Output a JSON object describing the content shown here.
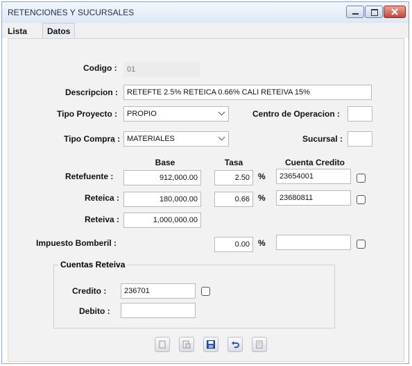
{
  "window": {
    "title": "RETENCIONES Y SUCURSALES"
  },
  "tabs": [
    {
      "label": "Lista"
    },
    {
      "label": "Datos"
    }
  ],
  "form": {
    "codigo": {
      "label": "Codigo :",
      "value": "01"
    },
    "descripcion": {
      "label": "Descripcion :",
      "value": "RETEFTE 2.5% RETEICA 0.66% CALI RETEIVA 15%"
    },
    "tipo_proyecto": {
      "label": "Tipo Proyecto :",
      "value": "PROPIO"
    },
    "centro_operacion": {
      "label": "Centro de Operacion :",
      "value": ""
    },
    "tipo_compra": {
      "label": "Tipo Compra :",
      "value": "MATERIALES"
    },
    "sucursal": {
      "label": "Sucursal :",
      "value": ""
    },
    "headers": {
      "base": "Base",
      "tasa": "Tasa",
      "cuenta": "Cuenta Credito"
    },
    "retefuente": {
      "label": "Retefuente :",
      "base": "912,000.00",
      "tasa": "2.50",
      "cuenta": "23654001"
    },
    "reteica": {
      "label": "Reteica :",
      "base": "180,000.00",
      "tasa": "0.66",
      "cuenta": "23680811"
    },
    "reteiva": {
      "label": "Reteiva :",
      "base": "1,000,000.00"
    },
    "bomberil": {
      "label": "Impuesto Bomberil :",
      "tasa": "0.00",
      "cuenta": ""
    },
    "percent": "%",
    "cuentas_reteiva": {
      "legend": "Cuentas Reteiva",
      "credito": {
        "label": "Credito :",
        "value": "236701"
      },
      "debito": {
        "label": "Debito :",
        "value": ""
      }
    }
  },
  "toolbar": [
    "new-icon",
    "edit-icon",
    "save-icon",
    "undo-icon",
    "delete-icon"
  ]
}
